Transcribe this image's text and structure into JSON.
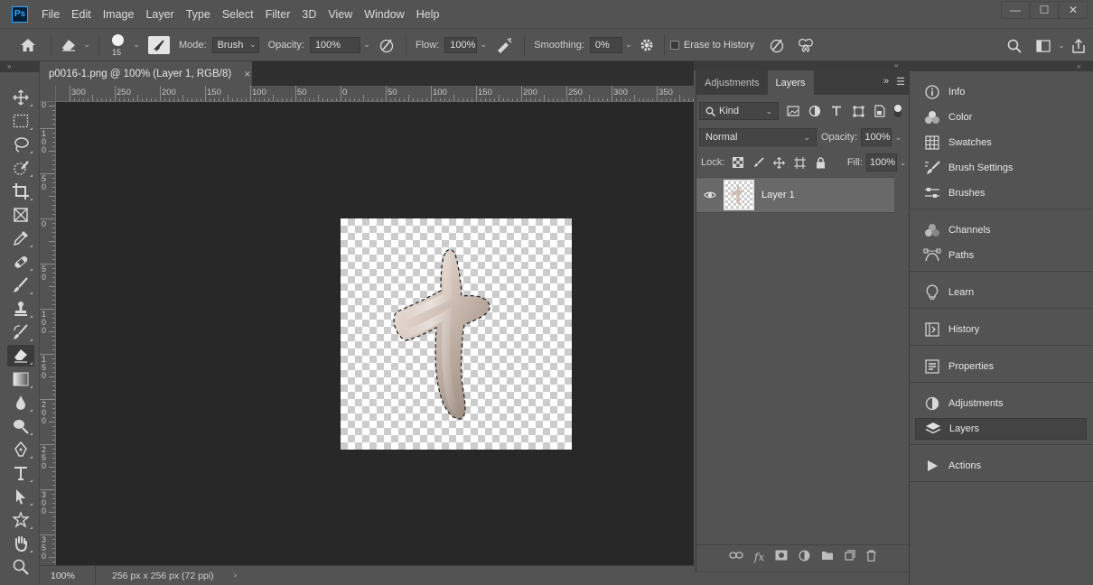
{
  "app": {
    "logo_text": "Ps",
    "menu": [
      "File",
      "Edit",
      "Image",
      "Layer",
      "Type",
      "Select",
      "Filter",
      "3D",
      "View",
      "Window",
      "Help"
    ],
    "window_controls": {
      "minimize": "—",
      "maximize": "☐",
      "close": "✕"
    }
  },
  "options_bar": {
    "brush_size": "15",
    "mode_label": "Mode:",
    "mode_value": "Brush",
    "opacity_label": "Opacity:",
    "opacity_value": "100%",
    "flow_label": "Flow:",
    "flow_value": "100%",
    "smoothing_label": "Smoothing:",
    "smoothing_value": "0%",
    "erase_to_history_label": "Erase to History"
  },
  "document": {
    "tab_title": "p0016-1.png @ 100% (Layer 1, RGB/8)",
    "tab_close": "×",
    "ruler_h_labels": [
      "300",
      "250",
      "200",
      "150",
      "100",
      "50",
      "0",
      "50",
      "100",
      "150",
      "200",
      "250",
      "300",
      "350"
    ],
    "ruler_v_labels": [
      [
        "2",
        "0"
      ],
      [
        "1",
        "5",
        "0"
      ],
      [
        "1",
        "0",
        "0"
      ],
      [
        "5",
        "0"
      ],
      [
        "0"
      ],
      [
        "5",
        "0"
      ],
      [
        "1",
        "0",
        "0"
      ],
      [
        "1",
        "5",
        "0"
      ],
      [
        "2",
        "0",
        "0"
      ],
      [
        "2",
        "5",
        "0"
      ],
      [
        "3",
        "0",
        "0"
      ],
      [
        "3",
        "5",
        "0"
      ]
    ],
    "zoom": "100%",
    "info": "256 px x 256 px (72 ppi)",
    "status_arrow": "›"
  },
  "layers_panel": {
    "tabs": [
      "Adjustments",
      "Layers"
    ],
    "active_tab": "Layers",
    "filter_kind": "Kind",
    "blend_mode": "Normal",
    "opacity_label": "Opacity:",
    "opacity_value": "100%",
    "lock_label": "Lock:",
    "fill_label": "Fill:",
    "fill_value": "100%",
    "layers": [
      {
        "name": "Layer 1",
        "visible": true
      }
    ]
  },
  "dock": {
    "groups": [
      [
        "Info",
        "Color",
        "Swatches",
        "Brush Settings",
        "Brushes"
      ],
      [
        "Channels",
        "Paths"
      ],
      [
        "Learn"
      ],
      [
        "History"
      ],
      [
        "Properties"
      ],
      [
        "Adjustments",
        "Layers"
      ],
      [
        "Actions"
      ]
    ],
    "active": "Layers"
  }
}
